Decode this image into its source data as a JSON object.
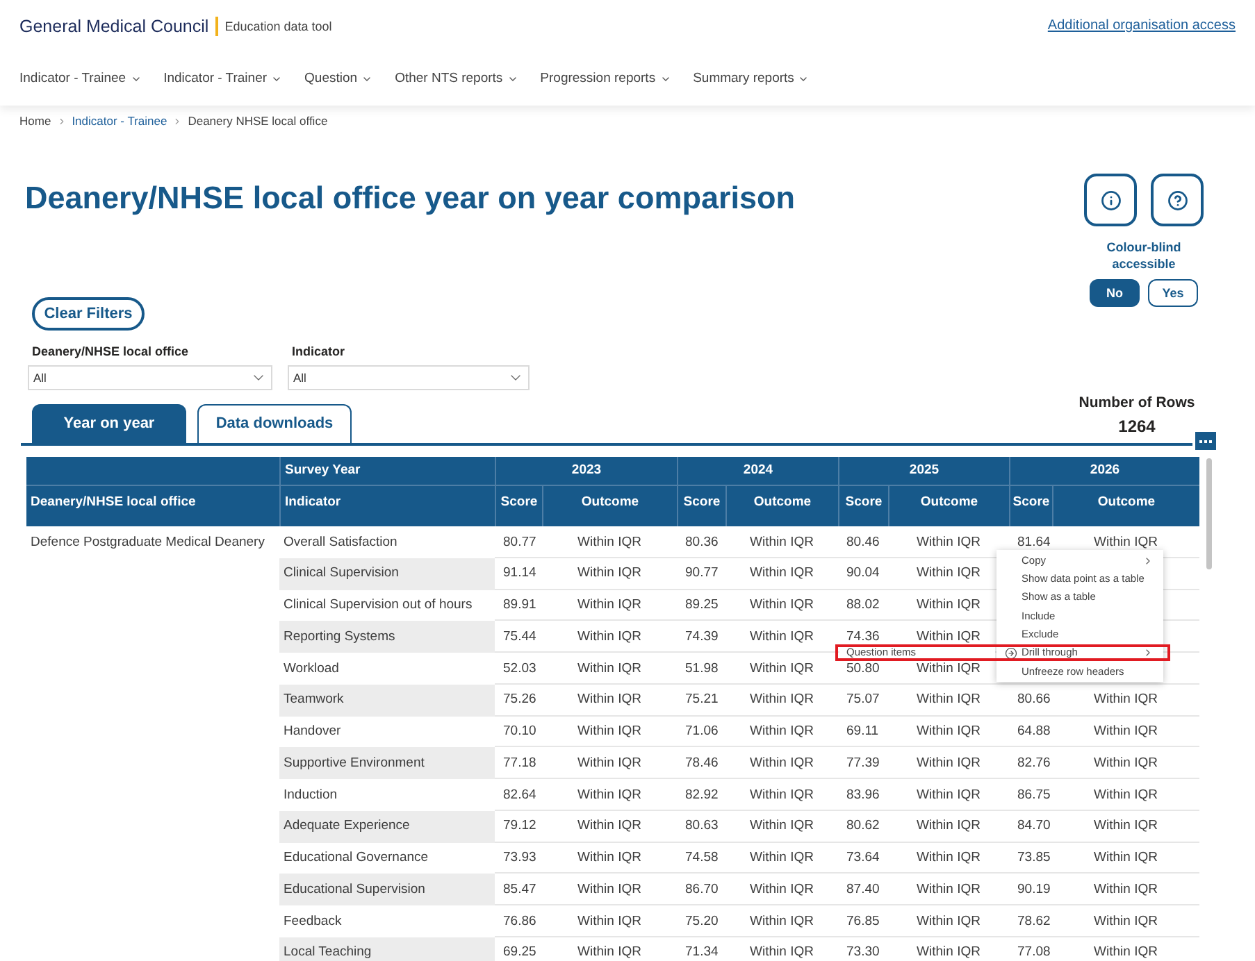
{
  "header": {
    "logo": "General Medical Council",
    "app_name": "Education data tool",
    "account_link": "Additional organisation access"
  },
  "nav": [
    {
      "label": "Indicator - Trainee"
    },
    {
      "label": "Indicator - Trainer"
    },
    {
      "label": "Question"
    },
    {
      "label": "Other NTS reports"
    },
    {
      "label": "Progression reports"
    },
    {
      "label": "Summary reports"
    }
  ],
  "breadcrumb": [
    {
      "label": "Home",
      "kind": "text"
    },
    {
      "label": "Indicator - Trainee",
      "kind": "link"
    },
    {
      "label": "Deanery NHSE local office",
      "kind": "text"
    }
  ],
  "page": {
    "title": "Deanery/NHSE local office year on year comparison"
  },
  "colour_blind": {
    "label": "Colour-blind accessible",
    "options": [
      {
        "label": "No",
        "selected": true
      },
      {
        "label": "Yes",
        "selected": false
      }
    ]
  },
  "filters": {
    "clear_button": "Clear Filters",
    "dropdowns": [
      {
        "label": "Deanery/NHSE local office",
        "value": "All"
      },
      {
        "label": "Indicator",
        "value": "All"
      }
    ]
  },
  "tabs": [
    {
      "label": "Year on year",
      "selected": true
    },
    {
      "label": "Data downloads",
      "selected": false
    }
  ],
  "row_count": {
    "label": "Number of Rows",
    "value": "1264"
  },
  "table": {
    "group_header": "Survey Year",
    "columns": [
      "Deanery/NHSE local office",
      "Indicator"
    ],
    "years": [
      {
        "label": "2023",
        "columns": [
          "Score",
          "Outcome"
        ]
      },
      {
        "label": "2024",
        "columns": [
          "Score",
          "Outcome"
        ]
      },
      {
        "label": "2025",
        "columns": [
          "Score",
          "Outcome"
        ]
      },
      {
        "label": "2026",
        "columns": [
          "Score",
          "Outcome"
        ]
      }
    ],
    "office": "Defence Postgraduate Medical Deanery",
    "rows": [
      {
        "indicator": "Overall Satisfaction",
        "years": [
          {
            "score": "80.77",
            "outcome": "Within IQR"
          },
          {
            "score": "80.36",
            "outcome": "Within IQR"
          },
          {
            "score": "80.46",
            "outcome": "Within IQR"
          },
          {
            "score": "81.64",
            "outcome": "Within IQR"
          }
        ]
      },
      {
        "indicator": "Clinical Supervision",
        "years": [
          {
            "score": "91.14",
            "outcome": "Within IQR"
          },
          {
            "score": "90.77",
            "outcome": "Within IQR"
          },
          {
            "score": "90.04",
            "outcome": "Within IQR"
          }
        ]
      },
      {
        "indicator": "Clinical Supervision out of hours",
        "years": [
          {
            "score": "89.91",
            "outcome": "Within IQR"
          },
          {
            "score": "89.25",
            "outcome": "Within IQR"
          },
          {
            "score": "88.02",
            "outcome": "Within IQR"
          }
        ]
      },
      {
        "indicator": "Reporting Systems",
        "years": [
          {
            "score": "75.44",
            "outcome": "Within IQR"
          },
          {
            "score": "74.39",
            "outcome": "Within IQR"
          },
          {
            "score": "74.36",
            "outcome": "Within IQR"
          }
        ]
      },
      {
        "indicator": "Workload",
        "years": [
          {
            "score": "52.03",
            "outcome": "Within IQR"
          },
          {
            "score": "51.98",
            "outcome": "Within IQR"
          },
          {
            "score": "50.80",
            "outcome": "Within IQR"
          }
        ]
      },
      {
        "indicator": "Teamwork",
        "years": [
          {
            "score": "75.26",
            "outcome": "Within IQR"
          },
          {
            "score": "75.21",
            "outcome": "Within IQR"
          },
          {
            "score": "75.07",
            "outcome": "Within IQR"
          },
          {
            "score": "80.66",
            "outcome": "Within IQR"
          }
        ]
      },
      {
        "indicator": "Handover",
        "years": [
          {
            "score": "70.10",
            "outcome": "Within IQR"
          },
          {
            "score": "71.06",
            "outcome": "Within IQR"
          },
          {
            "score": "69.11",
            "outcome": "Within IQR"
          },
          {
            "score": "64.88",
            "outcome": "Within IQR"
          }
        ]
      },
      {
        "indicator": "Supportive Environment",
        "years": [
          {
            "score": "77.18",
            "outcome": "Within IQR"
          },
          {
            "score": "78.46",
            "outcome": "Within IQR"
          },
          {
            "score": "77.39",
            "outcome": "Within IQR"
          },
          {
            "score": "82.76",
            "outcome": "Within IQR"
          }
        ]
      },
      {
        "indicator": "Induction",
        "years": [
          {
            "score": "82.64",
            "outcome": "Within IQR"
          },
          {
            "score": "82.92",
            "outcome": "Within IQR"
          },
          {
            "score": "83.96",
            "outcome": "Within IQR"
          },
          {
            "score": "86.75",
            "outcome": "Within IQR"
          }
        ]
      },
      {
        "indicator": "Adequate Experience",
        "years": [
          {
            "score": "79.12",
            "outcome": "Within IQR"
          },
          {
            "score": "80.63",
            "outcome": "Within IQR"
          },
          {
            "score": "80.62",
            "outcome": "Within IQR"
          },
          {
            "score": "84.70",
            "outcome": "Within IQR"
          }
        ]
      },
      {
        "indicator": "Educational Governance",
        "years": [
          {
            "score": "73.93",
            "outcome": "Within IQR"
          },
          {
            "score": "74.58",
            "outcome": "Within IQR"
          },
          {
            "score": "73.64",
            "outcome": "Within IQR"
          },
          {
            "score": "73.85",
            "outcome": "Within IQR"
          }
        ]
      },
      {
        "indicator": "Educational Supervision",
        "years": [
          {
            "score": "85.47",
            "outcome": "Within IQR"
          },
          {
            "score": "86.70",
            "outcome": "Within IQR"
          },
          {
            "score": "87.40",
            "outcome": "Within IQR"
          },
          {
            "score": "90.19",
            "outcome": "Within IQR"
          }
        ]
      },
      {
        "indicator": "Feedback",
        "years": [
          {
            "score": "76.86",
            "outcome": "Within IQR"
          },
          {
            "score": "75.20",
            "outcome": "Within IQR"
          },
          {
            "score": "76.85",
            "outcome": "Within IQR"
          },
          {
            "score": "78.62",
            "outcome": "Within IQR"
          }
        ]
      },
      {
        "indicator": "Local Teaching",
        "years": [
          {
            "score": "69.25",
            "outcome": "Within IQR"
          },
          {
            "score": "71.34",
            "outcome": "Within IQR"
          },
          {
            "score": "73.30",
            "outcome": "Within IQR"
          },
          {
            "score": "77.08",
            "outcome": "Within IQR"
          }
        ]
      }
    ]
  },
  "context_menu": {
    "items": [
      {
        "label": "Copy",
        "kind": "submenu",
        "highlighted": false
      },
      {
        "label": "Show data point as a table",
        "kind": "action",
        "highlighted": false
      },
      {
        "label": "Show as a table",
        "kind": "action",
        "highlighted": false
      },
      {
        "label": "Include",
        "kind": "action",
        "highlighted": false
      },
      {
        "label": "Exclude",
        "kind": "action",
        "highlighted": false
      },
      {
        "label": "Drill through",
        "kind": "drill",
        "highlighted": true
      },
      {
        "label": "Unfreeze row headers",
        "kind": "action",
        "highlighted": false
      }
    ],
    "submenu": [
      {
        "label": "Question items"
      }
    ]
  }
}
